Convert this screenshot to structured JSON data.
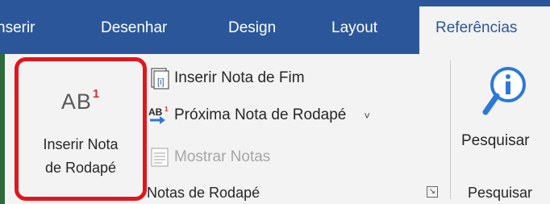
{
  "tabs": [
    {
      "label": "nserir"
    },
    {
      "label": "Desenhar"
    },
    {
      "label": "Design"
    },
    {
      "label": "Layout"
    },
    {
      "label": "Referências",
      "active": true
    }
  ],
  "big_button": {
    "icon_text": "AB",
    "icon_superscript": "1",
    "label_line1": "Inserir Nota",
    "label_line2": "de Rodapé",
    "highlight_color": "#e0161e"
  },
  "small_buttons": [
    {
      "label": "Inserir Nota de Fim",
      "icon": "insert-endnote-icon",
      "enabled": true
    },
    {
      "label": "Próxima Nota de Rodapé",
      "icon": "next-footnote-icon",
      "enabled": true,
      "dropdown": "˅"
    },
    {
      "label": "Mostrar Notas",
      "icon": "show-notes-icon",
      "enabled": false
    }
  ],
  "groups": {
    "footnotes_label": "Notas de Rodapé",
    "launcher_glyph": "↘",
    "search_label": "Pesquisar"
  },
  "search_button": {
    "label": "Pesquisar",
    "icon": "info-search-icon"
  },
  "colors": {
    "ribbon_tab_bar": "#2b579a",
    "ribbon_body": "#f3f3f3",
    "accent": "#2b579a"
  }
}
